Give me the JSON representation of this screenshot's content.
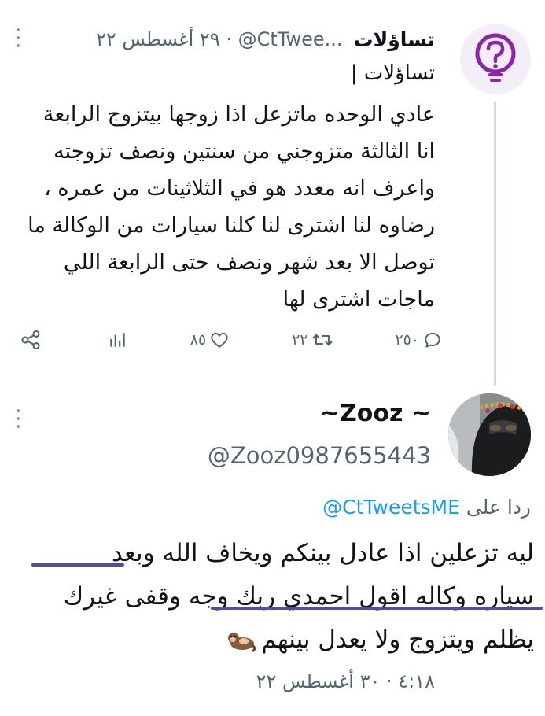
{
  "tweet": {
    "account_name": "تساؤلات",
    "handle_meta": "...CtTwee@ · ٢٩ أغسطس ٢٢",
    "subtitle": "تساؤلات |",
    "body_lines": [
      "عادي الوحده ماتزعل اذا زوجها بيتزوج الرابعة",
      "انا الثالثة متزوجني من سنتين ونصف تزوجته",
      "واعرف انه معدد هو في الثلاثينات من عمره ،",
      "رضاوه لنا اشترى لنا كلنا سيارات من الوكالة ما",
      "توصل الا بعد شهر ونصف حتى الرابعة اللي",
      "ماجات اشترى لها"
    ],
    "actions": {
      "reply_count": "٢٥٠",
      "retweet_count": "٢٢",
      "like_count": "٨٥",
      "views_label": "",
      "share_label": ""
    },
    "icons": [
      "question-bulb-icon",
      "more-icon",
      "reply-icon",
      "retweet-icon",
      "like-icon",
      "views-icon",
      "share-icon"
    ]
  },
  "reply": {
    "display_name": "~Zooz ~",
    "handle": "@Zooz0987655443",
    "replying_prefix": "ردا على",
    "replying_handle": "@CtTweetsME",
    "body_lines": [
      "ليه تزعلين اذا عادل بينكم ويخاف الله وبعد",
      "سياره وكاله اقول احمدي ربك وجه وقفى غيرك",
      "يظلم ويتزوج ولا  يعدل بينهم"
    ],
    "timestamp": "٤:١٨ · ٣٠ أغسطس ٢٢",
    "emoji_icon": "otter-emoji"
  },
  "colors": {
    "text": "#0f1419",
    "secondary": "#536471",
    "link": "#1d9bf0",
    "thread_line": "#cfd9de",
    "brand_purple": "#8e24aa",
    "underline": "#5b4b93"
  }
}
